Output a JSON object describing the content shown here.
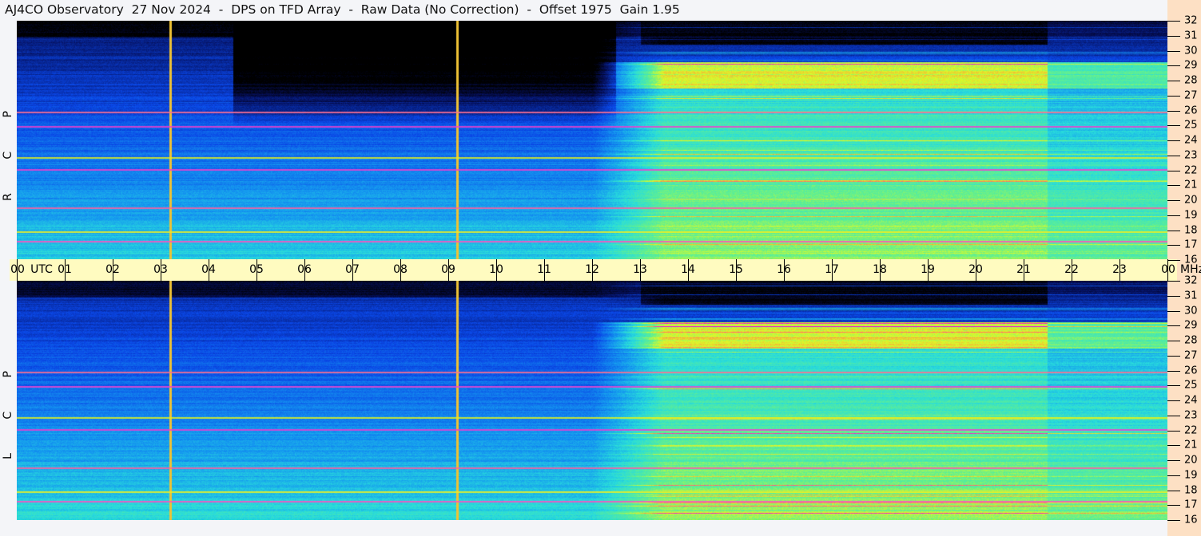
{
  "title": "AJ4CO Observatory  27 Nov 2024  -  DPS on TFD Array  -  Raw Data (No Correction)  -  Offset 1975  Gain 1.95",
  "chart_data": {
    "type": "heatmap",
    "title": "AJ4CO Observatory  27 Nov 2024  -  DPS on TFD Array  -  Raw Data (No Correction)  -  Offset 1975  Gain 1.95",
    "xlabel": "UTC",
    "ylabel": "MHz",
    "x_range": [
      0,
      24
    ],
    "x_ticks": [
      "00",
      "01",
      "02",
      "03",
      "04",
      "05",
      "06",
      "07",
      "08",
      "09",
      "10",
      "11",
      "12",
      "13",
      "14",
      "15",
      "16",
      "17",
      "18",
      "19",
      "20",
      "21",
      "22",
      "23",
      "00"
    ],
    "y_range": [
      16,
      32
    ],
    "y_ticks": [
      "16",
      "17",
      "18",
      "19",
      "20",
      "21",
      "22",
      "23",
      "24",
      "25",
      "26",
      "27",
      "28",
      "29",
      "30",
      "31",
      "32"
    ],
    "panels": [
      {
        "name": "RCP",
        "label": "R C P"
      },
      {
        "name": "LCP",
        "label": "L C P"
      }
    ],
    "markers_utc": [
      3.2,
      9.2
    ],
    "offset": 1975,
    "gain": 1.95,
    "colors": {
      "axis_band": "#fffbc0",
      "freq_strip": "#fde0c4",
      "marker": "#f4a070"
    }
  }
}
